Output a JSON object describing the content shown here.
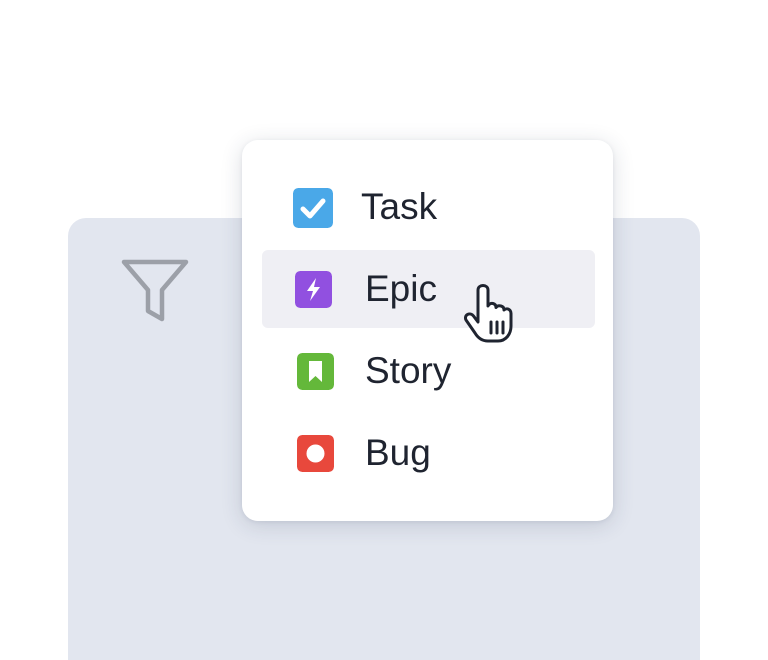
{
  "menu": {
    "items": [
      {
        "label": "Task",
        "icon": "checkbox-icon",
        "color": "#4aa8e8"
      },
      {
        "label": "Epic",
        "icon": "lightning-icon",
        "color": "#9150e0",
        "hovered": true
      },
      {
        "label": "Story",
        "icon": "bookmark-icon",
        "color": "#64b83a"
      },
      {
        "label": "Bug",
        "icon": "circle-icon",
        "color": "#e8483c"
      }
    ]
  },
  "toolbar": {
    "filter_icon": "filter-icon"
  },
  "colors": {
    "panel_background": "#e2e6ef",
    "menu_background": "#ffffff",
    "hover_background": "#efeff4",
    "filter_icon_stroke": "#9ca0a8"
  }
}
